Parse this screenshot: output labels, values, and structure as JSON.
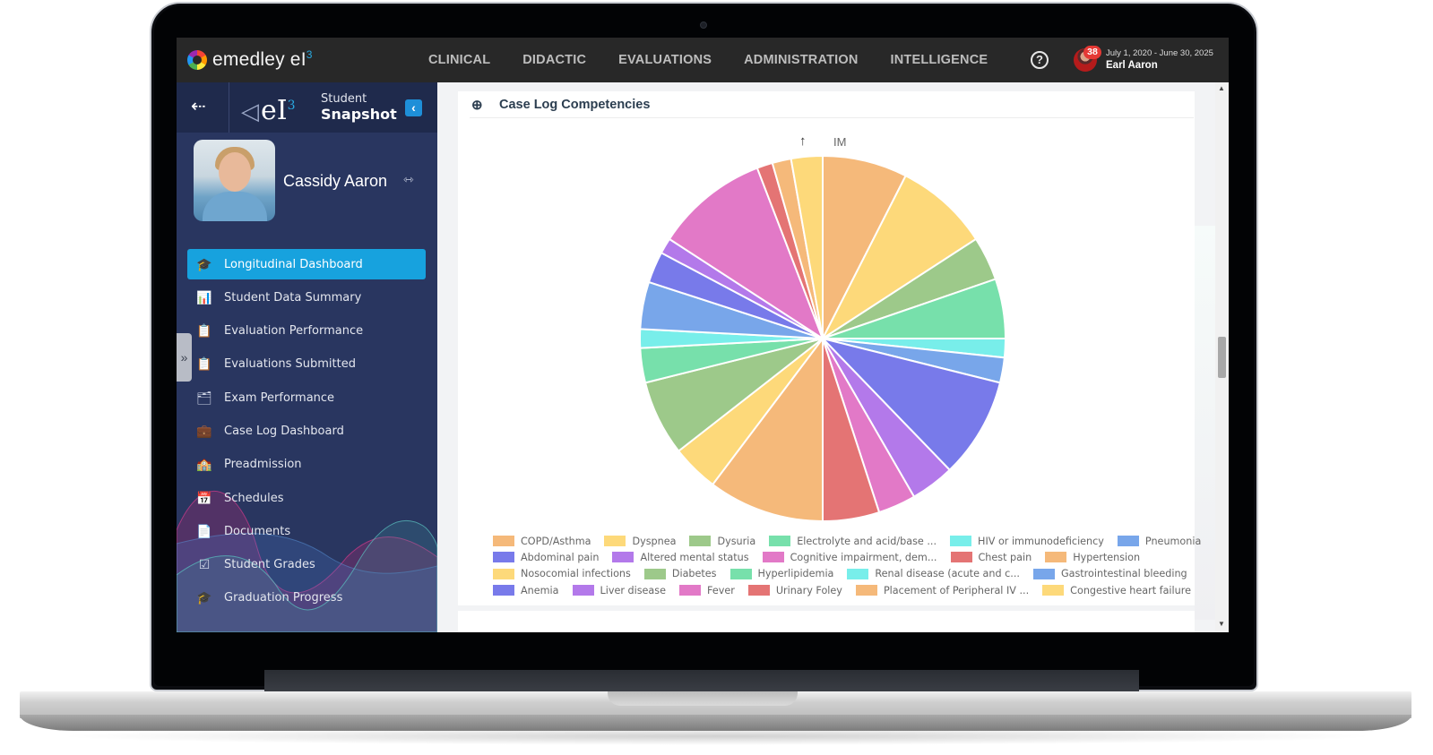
{
  "app": {
    "brand": "emedley eI",
    "brand_sup": "3",
    "nav": [
      "CLINICAL",
      "DIDACTIC",
      "EVALUATIONS",
      "ADMINISTRATION",
      "INTELLIGENCE"
    ],
    "help_icon": "?",
    "notification_count": "38",
    "user_period": "July 1, 2020 - June 30, 2025",
    "user_name": "Earl Aaron"
  },
  "sidebar": {
    "exit_icon": "⇠",
    "logo_text": "eI",
    "logo_sup": "3",
    "title_line1": "Student",
    "title_line2": "Snapshot",
    "collapse_icon": "‹",
    "student_name": "Cassidy Aaron",
    "swap_icon": "⇿",
    "handle_icon": "»",
    "items": [
      {
        "label": "Longitudinal Dashboard",
        "icon": "graduate-icon",
        "glyph": "🎓",
        "active": true
      },
      {
        "label": "Student Data Summary",
        "icon": "chart-icon",
        "glyph": "📊",
        "active": false
      },
      {
        "label": "Evaluation Performance",
        "icon": "clipboard-user-icon",
        "glyph": "📋",
        "active": false
      },
      {
        "label": "Evaluations Submitted",
        "icon": "clipboard-list-icon",
        "glyph": "📋",
        "active": false
      },
      {
        "label": "Exam Performance",
        "icon": "folders-icon",
        "glyph": "🗂",
        "active": false
      },
      {
        "label": "Case Log Dashboard",
        "icon": "medical-kit-icon",
        "glyph": "💼",
        "active": false
      },
      {
        "label": "Preadmission",
        "icon": "school-icon",
        "glyph": "🏫",
        "active": false
      },
      {
        "label": "Schedules",
        "icon": "calendar-icon",
        "glyph": "📅",
        "active": false
      },
      {
        "label": "Documents",
        "icon": "document-icon",
        "glyph": "📄",
        "active": false
      },
      {
        "label": "Student Grades",
        "icon": "checkbox-icon",
        "glyph": "☑",
        "active": false
      },
      {
        "label": "Graduation Progress",
        "icon": "graduation-cap-icon",
        "glyph": "🎓",
        "active": false
      }
    ]
  },
  "main": {
    "card_title": "Case Log Competencies",
    "zoom_icon": "⊕",
    "sort_icon": "↑",
    "group_label": "IM"
  },
  "chart_data": {
    "type": "pie",
    "title": "Case Log Competencies",
    "subtitle": "IM",
    "start_angle": "top, clockwise",
    "legend_position": "bottom",
    "slices": [
      {
        "label": "COPD/Asthma",
        "value": 27,
        "color": "#f5b97a"
      },
      {
        "label": "Dyspnea",
        "value": 30,
        "color": "#fdd97a"
      },
      {
        "label": "Dysuria",
        "value": 14,
        "color": "#9dc98a"
      },
      {
        "label": "Electrolyte and acid/base ...",
        "value": 19,
        "color": "#77e0ab"
      },
      {
        "label": "HIV or immunodeficiency",
        "value": 6,
        "color": "#78eeea"
      },
      {
        "label": "Pneumonia",
        "value": 8,
        "color": "#78a6ea"
      },
      {
        "label": "Abdominal pain",
        "value": 32,
        "color": "#787aea"
      },
      {
        "label": "Altered mental status",
        "value": 14,
        "color": "#b379ea"
      },
      {
        "label": "Cognitive impairment, dem...",
        "value": 12,
        "color": "#e279c7"
      },
      {
        "label": "Chest pain",
        "value": 18,
        "color": "#e47474"
      },
      {
        "label": "Hypertension",
        "value": 37,
        "color": "#f5b97a"
      },
      {
        "label": "Nosocomial infections",
        "value": 15,
        "color": "#fdd97a"
      },
      {
        "label": "Diabetes",
        "value": 24,
        "color": "#9dc98a"
      },
      {
        "label": "Hyperlipidemia",
        "value": 11,
        "color": "#77e0ab"
      },
      {
        "label": "Renal disease (acute and c...",
        "value": 6,
        "color": "#78eeea"
      },
      {
        "label": "Gastrointestinal bleeding",
        "value": 15,
        "color": "#78a6ea"
      },
      {
        "label": "Anemia",
        "value": 10,
        "color": "#787aea"
      },
      {
        "label": "Liver disease",
        "value": 5,
        "color": "#b379ea"
      },
      {
        "label": "Fever",
        "value": 36,
        "color": "#e279c7"
      },
      {
        "label": "Urinary Foley",
        "value": 5,
        "color": "#e47474"
      },
      {
        "label": "Placement of Peripheral IV ...",
        "value": 6,
        "color": "#f5b97a"
      },
      {
        "label": "Congestive heart failure",
        "value": 10,
        "color": "#fdd97a"
      }
    ],
    "legend_rows": [
      [
        0,
        1,
        2,
        3,
        4,
        5
      ],
      [
        6,
        7,
        8,
        9,
        10
      ],
      [
        11,
        12,
        13,
        14,
        15
      ],
      [
        16,
        17,
        18,
        19,
        20,
        21
      ]
    ]
  }
}
